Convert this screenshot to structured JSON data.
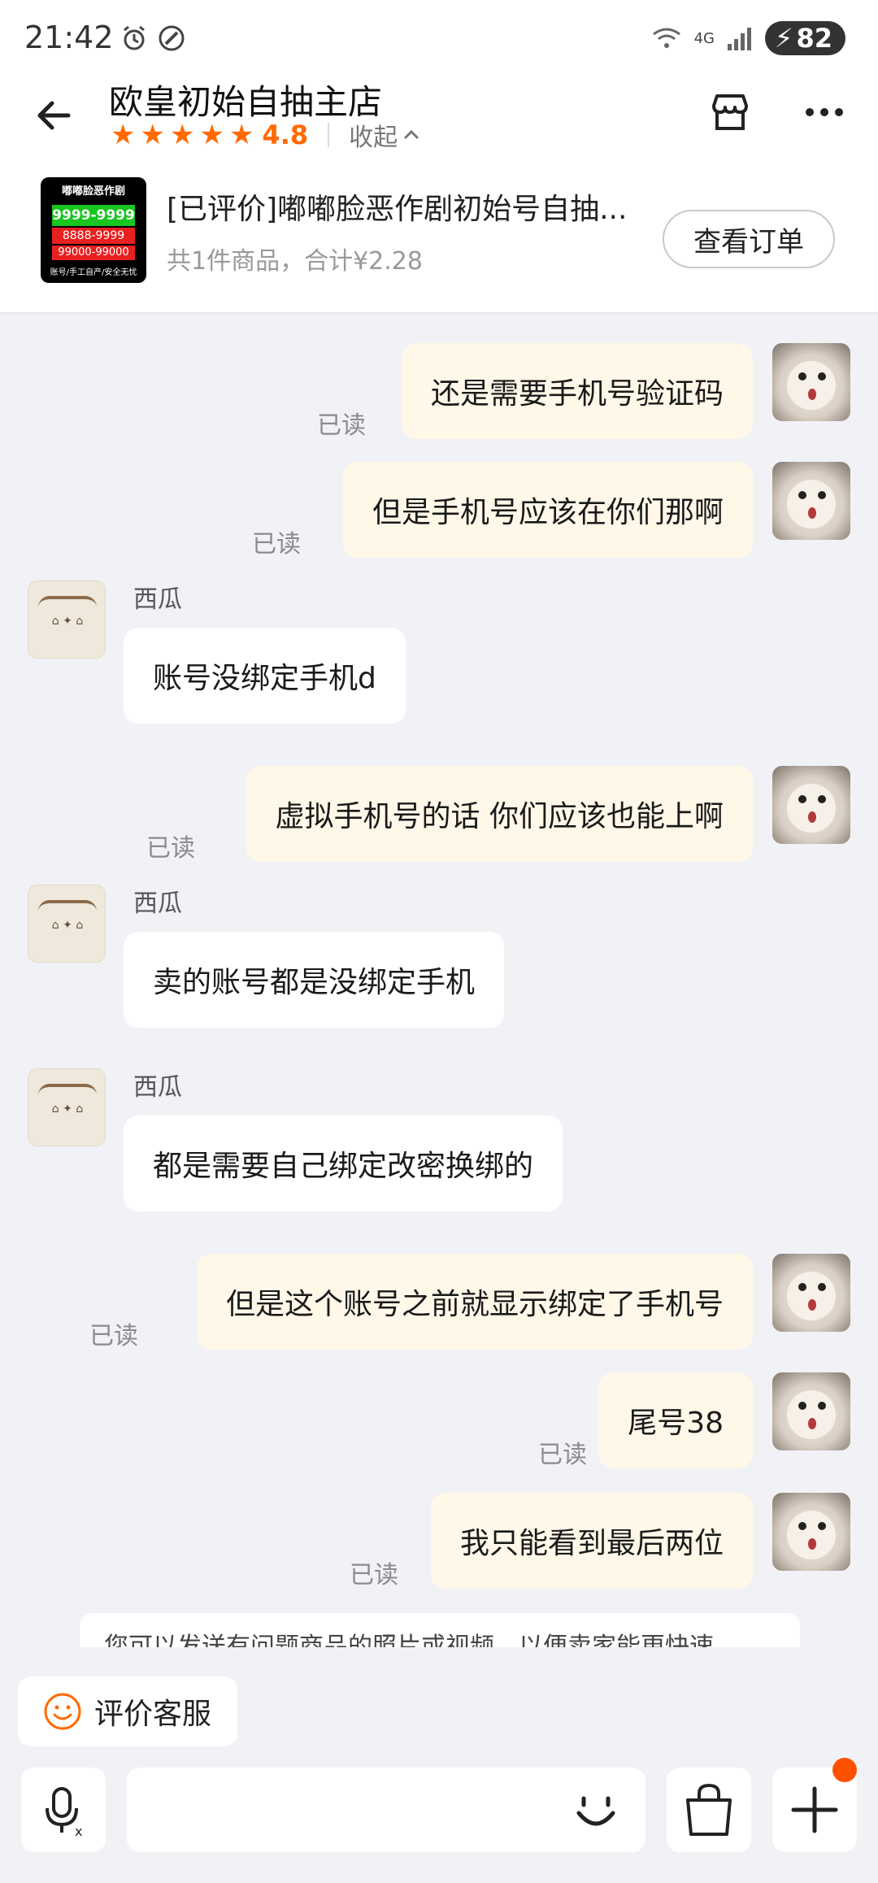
{
  "status_bar": {
    "time": "21:42",
    "network": "4G",
    "battery": "82"
  },
  "header": {
    "shop_name": "欧皇初始自抽主店",
    "rating": "4.8",
    "collapse_label": "收起"
  },
  "product": {
    "thumb_title": "嘟嘟脸恶作剧",
    "thumb_price": "9999-9999",
    "thumb_line3": "8888-9999",
    "thumb_line4": "99000-99000",
    "thumb_footer": "账号/手工自产/安全无忧",
    "title": "[已评价]嘟嘟脸恶作剧初始号自抽...",
    "summary": "共1件商品，合计¥2.28",
    "view_order_label": "查看订单"
  },
  "messages": [
    {
      "from": "me",
      "text": "还是需要手机号验证码",
      "status": "已读"
    },
    {
      "from": "me",
      "text": "但是手机号应该在你们那啊",
      "status": "已读"
    },
    {
      "from": "seller",
      "sender": "西瓜",
      "text": "账号没绑定手机d"
    },
    {
      "from": "me",
      "text": "虚拟手机号的话 你们应该也能上啊",
      "status": "已读"
    },
    {
      "from": "seller",
      "sender": "西瓜",
      "text": "卖的账号都是没绑定手机"
    },
    {
      "from": "seller",
      "sender": "西瓜",
      "text": "都是需要自己绑定改密换绑的"
    },
    {
      "from": "me",
      "text": "但是这个账号之前就显示绑定了手机号",
      "status": "已读"
    },
    {
      "from": "me",
      "text": "尾号38",
      "status": "已读"
    },
    {
      "from": "me",
      "text": "我只能看到最后两位",
      "status": "已读"
    }
  ],
  "tip": "您可以发送有问题商品的照片或视频，以便卖家能更快速",
  "bottom": {
    "rate_service_label": "评价客服"
  },
  "colors": {
    "accent": "#ff6a00",
    "outgoing_bubble": "#fff7e8",
    "badge": "#ff5000"
  }
}
